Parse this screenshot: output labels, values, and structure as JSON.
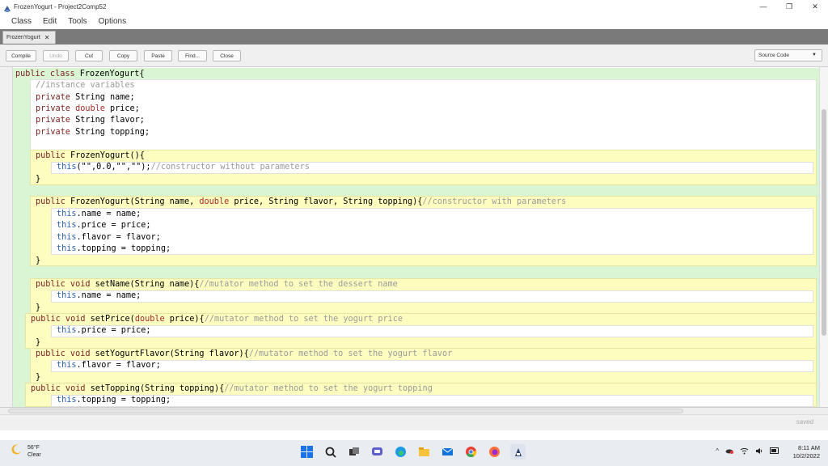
{
  "window": {
    "title": "FrozenYogurt - Project2Comp52",
    "minimize": "—",
    "maximize": "❐",
    "close": "✕"
  },
  "menu": [
    "Class",
    "Edit",
    "Tools",
    "Options"
  ],
  "tab": {
    "label": "FrozenYogurt",
    "close": "✕"
  },
  "toolbar": {
    "compile": "Compile",
    "undo": "Undo",
    "cut": "Cut",
    "copy": "Copy",
    "paste": "Paste",
    "find": "Find...",
    "close": "Close",
    "view": "Source Code"
  },
  "code": [
    {
      "segs": [
        [
          "kw",
          "public class "
        ],
        [
          "pl",
          "FrozenYogurt{"
        ]
      ]
    },
    {
      "segs": [
        [
          "cm",
          "//instance variables"
        ]
      ]
    },
    {
      "segs": [
        [
          "kw",
          "private "
        ],
        [
          "pl",
          "String name;"
        ]
      ]
    },
    {
      "segs": [
        [
          "kw",
          "private "
        ],
        [
          "kw2",
          "double "
        ],
        [
          "pl",
          "price;"
        ]
      ]
    },
    {
      "segs": [
        [
          "kw",
          "private "
        ],
        [
          "pl",
          "String flavor;"
        ]
      ]
    },
    {
      "segs": [
        [
          "kw",
          "private "
        ],
        [
          "pl",
          "String topping;"
        ]
      ]
    },
    {
      "segs": [
        [
          "kw",
          "public "
        ],
        [
          "pl",
          "FrozenYogurt(){"
        ]
      ]
    },
    {
      "segs": [
        [
          "th",
          "this"
        ],
        [
          "pl",
          "(\"\",0.0,\"\",\"\");"
        ],
        [
          "cm",
          "//constructor without parameters"
        ]
      ]
    },
    {
      "segs": [
        [
          "pl",
          "}"
        ]
      ]
    },
    {
      "segs": [
        [
          "kw",
          "public "
        ],
        [
          "pl",
          "FrozenYogurt(String name, "
        ],
        [
          "kw2",
          "double "
        ],
        [
          "pl",
          "price, String flavor, String topping){"
        ],
        [
          "cm",
          "//constructor with parameters"
        ]
      ]
    },
    {
      "segs": [
        [
          "th",
          "this"
        ],
        [
          "pl",
          ".name = name;"
        ]
      ]
    },
    {
      "segs": [
        [
          "th",
          "this"
        ],
        [
          "pl",
          ".price = price;"
        ]
      ]
    },
    {
      "segs": [
        [
          "th",
          "this"
        ],
        [
          "pl",
          ".flavor = flavor;"
        ]
      ]
    },
    {
      "segs": [
        [
          "th",
          "this"
        ],
        [
          "pl",
          ".topping = topping;"
        ]
      ]
    },
    {
      "segs": [
        [
          "pl",
          "}"
        ]
      ]
    },
    {
      "segs": [
        [
          "kw",
          "public void "
        ],
        [
          "pl",
          "setName(String name){"
        ],
        [
          "cm",
          "//mutator method to set the dessert name"
        ]
      ]
    },
    {
      "segs": [
        [
          "th",
          "this"
        ],
        [
          "pl",
          ".name = name;"
        ]
      ]
    },
    {
      "segs": [
        [
          "pl",
          "}"
        ]
      ]
    },
    {
      "segs": [
        [
          "kw",
          "public void "
        ],
        [
          "pl",
          "setPrice("
        ],
        [
          "kw2",
          "double "
        ],
        [
          "pl",
          "price){"
        ],
        [
          "cm",
          "//mutator method to set the yogurt price"
        ]
      ]
    },
    {
      "segs": [
        [
          "th",
          "this"
        ],
        [
          "pl",
          ".price = price;"
        ]
      ]
    },
    {
      "segs": [
        [
          "pl",
          "}"
        ]
      ]
    },
    {
      "segs": [
        [
          "kw",
          "public void "
        ],
        [
          "pl",
          "setYogurtFlavor(String flavor){"
        ],
        [
          "cm",
          "//mutator method to set the yogurt flavor"
        ]
      ]
    },
    {
      "segs": [
        [
          "th",
          "this"
        ],
        [
          "pl",
          ".flavor = flavor;"
        ]
      ]
    },
    {
      "segs": [
        [
          "pl",
          "}"
        ]
      ]
    },
    {
      "segs": [
        [
          "kw",
          "public void "
        ],
        [
          "pl",
          "setTopping(String topping){"
        ],
        [
          "cm",
          "//mutator method to set the yogurt topping"
        ]
      ]
    },
    {
      "segs": [
        [
          "th",
          "this"
        ],
        [
          "pl",
          ".topping = topping;"
        ]
      ]
    }
  ],
  "status": {
    "text": "saved"
  },
  "taskbar": {
    "weather_temp": "56°F",
    "weather_desc": "Clear",
    "time": "8:11 AM",
    "date": "10/2/2022",
    "icons": [
      "start-icon",
      "search-icon",
      "task-view-icon",
      "teams-chat-icon",
      "edge-icon",
      "file-explorer-icon",
      "mail-icon",
      "chrome-icon",
      "firefox-icon",
      "bluej-icon"
    ]
  },
  "colors": {
    "class_bg": "#d9f5d3",
    "method_bg": "#fdfdc0",
    "keyword": "#7a1f1f",
    "this_kw": "#2b5fa6",
    "comment": "#9a9a9a"
  }
}
